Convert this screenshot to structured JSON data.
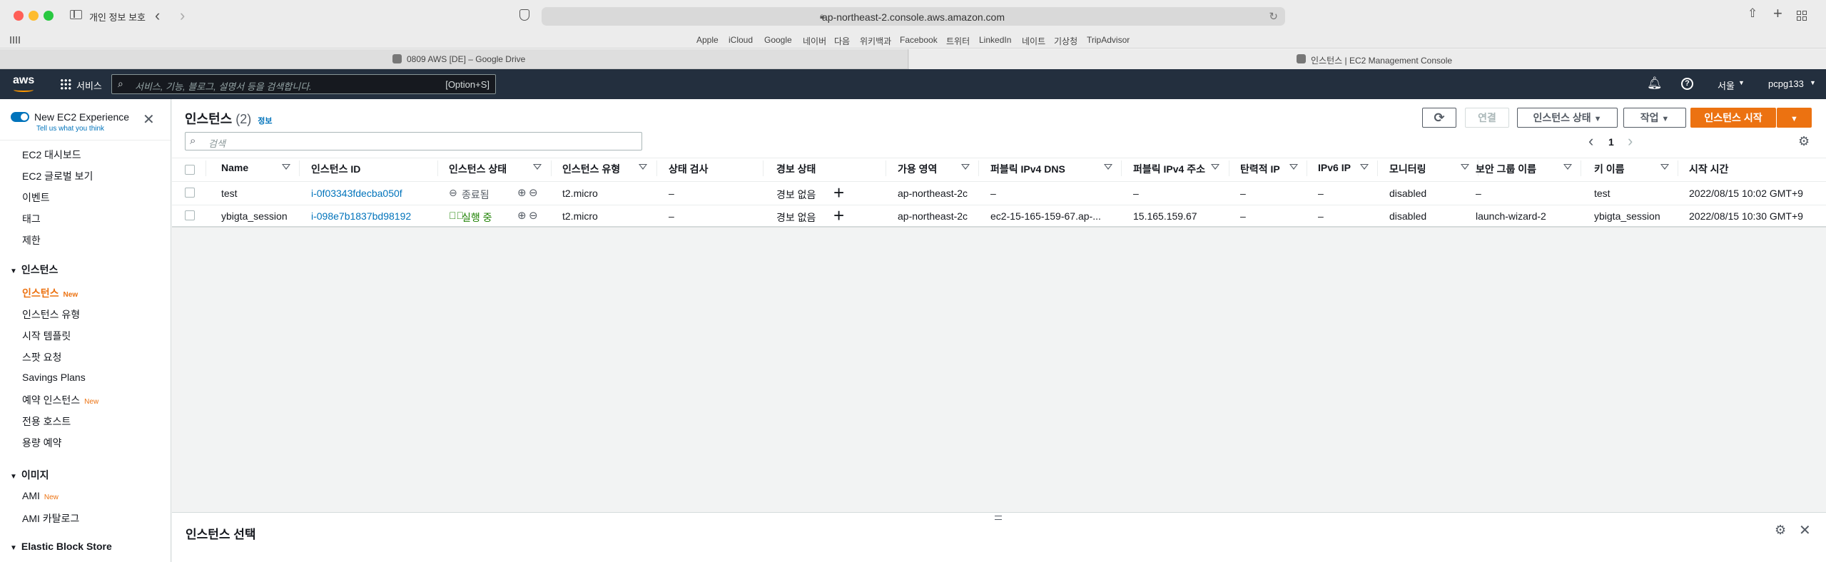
{
  "browser": {
    "privacy_label": "개인 정보 보호",
    "url": "ap-northeast-2.console.aws.amazon.com",
    "bookmarks": [
      "Apple",
      "iCloud",
      "Google",
      "네이버",
      "다음",
      "위키백과",
      "Facebook",
      "트위터",
      "LinkedIn",
      "네이트",
      "기상청",
      "TripAdvisor"
    ],
    "tabs": [
      {
        "title": "0809 AWS [DE] – Google Drive",
        "favicon": "drive-favicon-icon",
        "active": false
      },
      {
        "title": "인스턴스 | EC2 Management Console",
        "favicon": "aws-favicon-icon",
        "active": true
      }
    ]
  },
  "aws_nav": {
    "logo": "aws",
    "services": "서비스",
    "search_placeholder": "서비스, 기능, 블로그, 설명서 등을 검색합니다.",
    "search_shortcut": "[Option+S]",
    "region": "서울",
    "account": "pcpg133"
  },
  "sidebar": {
    "toggle_label": "New EC2 Experience",
    "feedback": "Tell us what you think",
    "top_items": [
      "EC2 대시보드",
      "EC2 글로벌 보기",
      "이벤트",
      "태그",
      "제한"
    ],
    "sections": [
      {
        "title": "인스턴스",
        "items": [
          {
            "label": "인스턴스",
            "badge": "New",
            "active": true
          },
          {
            "label": "인스턴스 유형",
            "badge": ""
          },
          {
            "label": "시작 템플릿",
            "badge": ""
          },
          {
            "label": "스팟 요청",
            "badge": ""
          },
          {
            "label": "Savings Plans",
            "badge": ""
          },
          {
            "label": "예약 인스턴스",
            "badge": "New"
          },
          {
            "label": "전용 호스트",
            "badge": ""
          },
          {
            "label": "용량 예약",
            "badge": ""
          }
        ]
      },
      {
        "title": "이미지",
        "items": [
          {
            "label": "AMI",
            "badge": "New"
          },
          {
            "label": "AMI 카탈로그",
            "badge": ""
          }
        ]
      },
      {
        "title": "Elastic Block Store",
        "items": []
      }
    ]
  },
  "instances": {
    "title": "인스턴스",
    "count": "(2)",
    "info": "정보",
    "buttons": {
      "connect": "연결",
      "state": "인스턴스 상태",
      "actions": "작업",
      "launch": "인스턴스 시작"
    },
    "search_placeholder": "검색",
    "page": "1",
    "columns": [
      "Name",
      "인스턴스 ID",
      "인스턴스 상태",
      "인스턴스 유형",
      "상태 검사",
      "경보 상태",
      "가용 영역",
      "퍼블릭 IPv4 DNS",
      "퍼블릭 IPv4 주소",
      "탄력적 IP",
      "IPv6 IP",
      "모니터링",
      "보안 그룹 이름",
      "키 이름",
      "시작 시간"
    ],
    "rows": [
      {
        "name": "test",
        "id": "i-0f03343fdecba050f",
        "state": "종료됨",
        "state_kind": "stopped",
        "type": "t2.micro",
        "check": "–",
        "alarm": "경보 없음",
        "az": "ap-northeast-2c",
        "dns": "–",
        "ipv4": "–",
        "eip": "–",
        "ipv6": "–",
        "monitoring": "disabled",
        "sg": "–",
        "key": "test",
        "launch": "2022/08/15 10:02 GMT+9"
      },
      {
        "name": "ybigta_session",
        "id": "i-098e7b1837bd98192",
        "state": "실행 중",
        "state_kind": "running",
        "type": "t2.micro",
        "check": "–",
        "alarm": "경보 없음",
        "az": "ap-northeast-2c",
        "dns": "ec2-15-165-159-67.ap-...",
        "ipv4": "15.165.159.67",
        "eip": "–",
        "ipv6": "–",
        "monitoring": "disabled",
        "sg": "launch-wizard-2",
        "key": "ybigta_session",
        "launch": "2022/08/15 10:30 GMT+9"
      }
    ]
  },
  "bottom_panel": {
    "title": "인스턴스 선택"
  },
  "colors": {
    "aws_nav": "#232f3e",
    "link": "#0073bb",
    "accent": "#ec7211",
    "running": "#1d8102"
  }
}
